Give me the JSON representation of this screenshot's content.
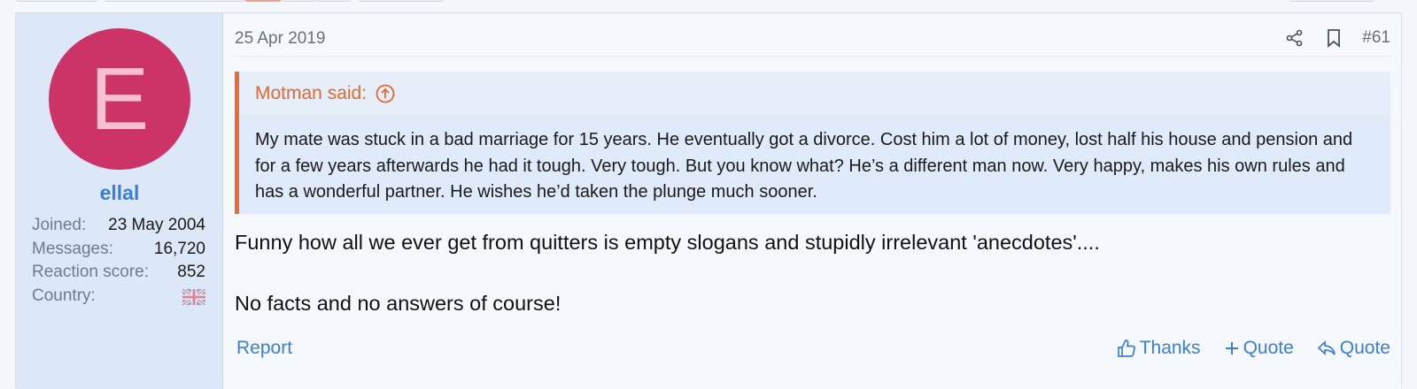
{
  "post": {
    "date": "25 Apr 2019",
    "number": "#61",
    "header_icons": [
      "share-icon",
      "bookmark-icon"
    ]
  },
  "user": {
    "avatar_letter": "E",
    "avatar_color": "#cc3366",
    "username": "ellal",
    "stats": [
      {
        "key": "Joined:",
        "value": "23 May 2004"
      },
      {
        "key": "Messages:",
        "value": "16,720"
      },
      {
        "key": "Reaction score:",
        "value": "852"
      },
      {
        "key": "Country:",
        "value": ""
      }
    ],
    "country_flag": "uk-flag-icon"
  },
  "quote": {
    "author": "Motman said:",
    "text": "My mate was stuck in a bad marriage for 15 years. He eventually got a divorce. Cost him a lot of money, lost half his house and pension and for a few years afterwards he had it tough. Very tough. But you know what? He’s a different man now. Very happy, makes his own rules and has a wonderful partner. He wishes he’d taken the plunge much sooner."
  },
  "message": {
    "paragraphs": [
      "Funny how all we ever get from quitters is empty slogans and stupidly irrelevant 'anecdotes'....",
      "No facts and no answers of course!"
    ]
  },
  "footer": {
    "report": "Report",
    "thanks": "Thanks",
    "multiquote": "Quote",
    "quote": "Quote"
  },
  "colors": {
    "accent": "#3b7fd4",
    "quote_border": "#ec6b35",
    "sidebar_bg": "#dce8f8"
  }
}
